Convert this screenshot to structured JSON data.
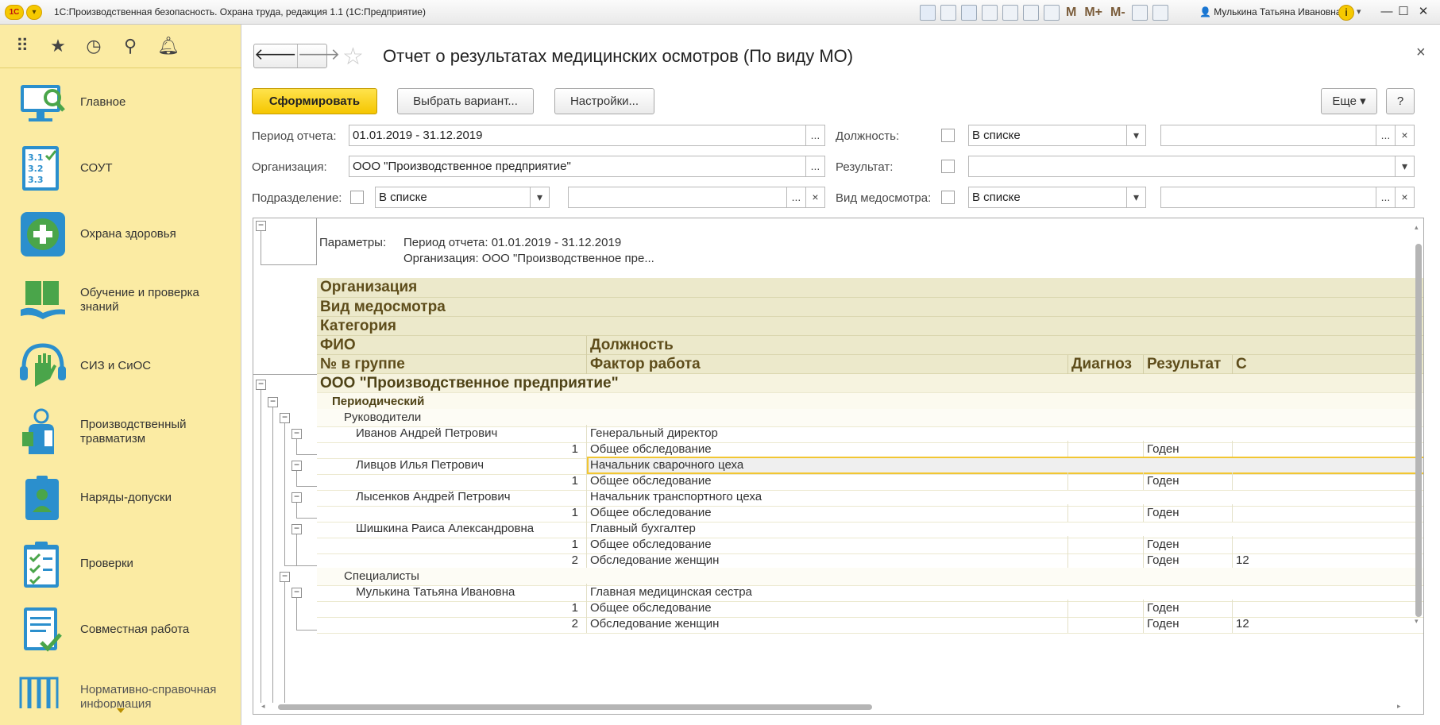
{
  "titlebar": {
    "logo": "1С",
    "title": "1С:Производственная безопасность. Охрана труда, редакция 1.1  (1С:Предприятие)",
    "tools": [
      "save-icon",
      "print-icon",
      "preview-icon",
      "upload-icon",
      "download-icon",
      "calculator-icon",
      "calendar-icon"
    ],
    "m_buttons": [
      "M",
      "M+",
      "M-"
    ],
    "user": "Мулькина Татьяна Ивановна",
    "info": "i",
    "minimize": "—",
    "maximize": "☐",
    "close": "✕"
  },
  "sidebar": {
    "top_icons": [
      "apps-grid-icon",
      "favorites-star-icon",
      "history-icon",
      "search-icon",
      "notifications-bell-icon"
    ],
    "items": [
      {
        "label": "Главное",
        "icon": "monitor-magnifier-icon"
      },
      {
        "label": "СОУТ",
        "icon": "checklist-icon"
      },
      {
        "label": "Охрана здоровья",
        "icon": "medical-cross-icon"
      },
      {
        "label": "Обучение и проверка знаний",
        "icon": "book-hand-icon"
      },
      {
        "label": "СИЗ и СиОС",
        "icon": "glove-headphones-icon"
      },
      {
        "label": "Производственный травматизм",
        "icon": "injured-worker-icon"
      },
      {
        "label": "Наряды-допуски",
        "icon": "permit-badge-icon"
      },
      {
        "label": "Проверки",
        "icon": "clipboard-check-icon"
      },
      {
        "label": "Совместная работа",
        "icon": "document-check-icon"
      },
      {
        "label": "Нормативно-справочная информация",
        "icon": "binders-icon"
      }
    ]
  },
  "main": {
    "title": "Отчет о результатах медицинских осмотров (По виду МО)",
    "back": "🡐",
    "forward": "🡒",
    "close": "×",
    "buttons": {
      "generate": "Сформировать",
      "choose_variant": "Выбрать вариант...",
      "settings": "Настройки...",
      "more": "Еще ▾",
      "help": "?"
    },
    "filters": {
      "period_label": "Период отчета:",
      "period_value": "01.01.2019 - 31.12.2019",
      "org_label": "Организация:",
      "org_value": "ООО \"Производственное предприятие\"",
      "subdiv_label": "Подразделение:",
      "subdiv_mode": "В списке",
      "position_label": "Должность:",
      "position_mode": "В списке",
      "result_label": "Результат:",
      "exam_type_label": "Вид медосмотра:",
      "exam_type_mode": "В списке",
      "ellipsis": "...",
      "clear": "×",
      "dropdown": "▾"
    }
  },
  "report": {
    "params_label": "Параметры:",
    "params_period": "Период отчета: 01.01.2019 - 31.12.2019",
    "params_org": "Организация: ООО \"Производственное пре...",
    "headers": {
      "organization": "Организация",
      "exam_type": "Вид медосмотра",
      "category": "Категория",
      "fio": "ФИО",
      "position": "Должность",
      "group_no": "№ в группе",
      "factor": "Фактор работа",
      "diagnosis": "Диагноз",
      "result": "Результат",
      "extra": "С"
    },
    "rows": [
      {
        "type": "org",
        "text": "ООО \"Производственное предприятие\""
      },
      {
        "type": "exam",
        "text": "Периодический"
      },
      {
        "type": "cat",
        "text": "Руководители"
      },
      {
        "type": "person",
        "fio": "Иванов Андрей Петрович",
        "position": "Генеральный директор"
      },
      {
        "type": "exam_row",
        "num": "1",
        "factor": "Общее обследование",
        "result": "Годен",
        "extra": ""
      },
      {
        "type": "person",
        "fio": "Ливцов Илья Петрович",
        "position": "Начальник  сварочного цеха",
        "selected": true
      },
      {
        "type": "exam_row",
        "num": "1",
        "factor": "Общее обследование",
        "result": "Годен",
        "extra": ""
      },
      {
        "type": "person",
        "fio": "Лысенков Андрей Петрович",
        "position": "Начальник транспортного цеха"
      },
      {
        "type": "exam_row",
        "num": "1",
        "factor": "Общее обследование",
        "result": "Годен",
        "extra": ""
      },
      {
        "type": "person",
        "fio": "Шишкина Раиса Александровна",
        "position": "Главный бухгалтер"
      },
      {
        "type": "exam_row",
        "num": "1",
        "factor": "Общее обследование",
        "result": "Годен",
        "extra": ""
      },
      {
        "type": "exam_row",
        "num": "2",
        "factor": "Обследование женщин",
        "result": "Годен",
        "extra": "12"
      },
      {
        "type": "cat",
        "text": "Специалисты"
      },
      {
        "type": "person",
        "fio": "Мулькина Татьяна Ивановна",
        "position": "Главная медицинская сестра"
      },
      {
        "type": "exam_row",
        "num": "1",
        "factor": "Общее обследование",
        "result": "Годен",
        "extra": ""
      },
      {
        "type": "exam_row",
        "num": "2",
        "factor": "Обследование женщин",
        "result": "Годен",
        "extra": "12"
      }
    ]
  },
  "colors": {
    "accent": "#f5c600",
    "sidebar_bg": "#fbeba3",
    "header_bg": "#ece9cb"
  }
}
